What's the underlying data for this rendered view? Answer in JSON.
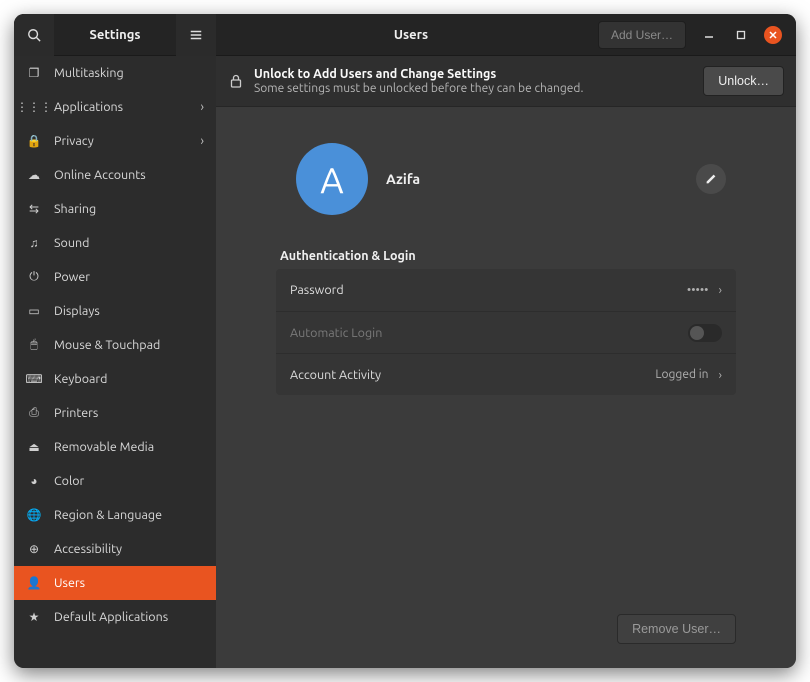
{
  "sidebar": {
    "title": "Settings",
    "items": [
      {
        "id": "multitasking",
        "label": "Multitasking",
        "icon": "multitasking",
        "arrow": false
      },
      {
        "id": "applications",
        "label": "Applications",
        "icon": "applications",
        "arrow": true
      },
      {
        "id": "privacy",
        "label": "Privacy",
        "icon": "privacy",
        "arrow": true
      },
      {
        "id": "online-accounts",
        "label": "Online Accounts",
        "icon": "cloud",
        "arrow": false
      },
      {
        "id": "sharing",
        "label": "Sharing",
        "icon": "sharing",
        "arrow": false
      },
      {
        "id": "sound",
        "label": "Sound",
        "icon": "sound",
        "arrow": false
      },
      {
        "id": "power",
        "label": "Power",
        "icon": "power",
        "arrow": false
      },
      {
        "id": "displays",
        "label": "Displays",
        "icon": "displays",
        "arrow": false
      },
      {
        "id": "mouse",
        "label": "Mouse & Touchpad",
        "icon": "mouse",
        "arrow": false
      },
      {
        "id": "keyboard",
        "label": "Keyboard",
        "icon": "keyboard",
        "arrow": false
      },
      {
        "id": "printers",
        "label": "Printers",
        "icon": "printers",
        "arrow": false
      },
      {
        "id": "removable",
        "label": "Removable Media",
        "icon": "removable",
        "arrow": false
      },
      {
        "id": "color",
        "label": "Color",
        "icon": "color",
        "arrow": false
      },
      {
        "id": "region",
        "label": "Region & Language",
        "icon": "region",
        "arrow": false
      },
      {
        "id": "accessibility",
        "label": "Accessibility",
        "icon": "accessibility",
        "arrow": false
      },
      {
        "id": "users",
        "label": "Users",
        "icon": "users",
        "arrow": false,
        "active": true
      },
      {
        "id": "default-apps",
        "label": "Default Applications",
        "icon": "star",
        "arrow": false
      }
    ]
  },
  "header": {
    "title": "Users",
    "add_user_label": "Add User…"
  },
  "banner": {
    "title": "Unlock to Add Users and Change Settings",
    "subtitle": "Some settings must be unlocked before they can be changed.",
    "unlock_label": "Unlock…"
  },
  "user": {
    "name": "Azifa",
    "initial": "A",
    "avatar_color": "#4a90d9"
  },
  "auth": {
    "section_label": "Authentication & Login",
    "password_label": "Password",
    "password_value": "•••••",
    "autologin_label": "Automatic Login",
    "autologin_enabled": false,
    "activity_label": "Account Activity",
    "activity_value": "Logged in"
  },
  "footer": {
    "remove_label": "Remove User…"
  },
  "icons": {
    "multitasking": "❐",
    "applications": "⋮⋮⋮",
    "privacy": "🔒",
    "cloud": "☁",
    "sharing": "⇆",
    "sound": "♫",
    "power": "⏻",
    "displays": "▭",
    "mouse": "🖱",
    "keyboard": "⌨",
    "printers": "⎙",
    "removable": "⏏",
    "color": "◕",
    "region": "🌐",
    "accessibility": "⊕",
    "users": "👤",
    "star": "★"
  }
}
